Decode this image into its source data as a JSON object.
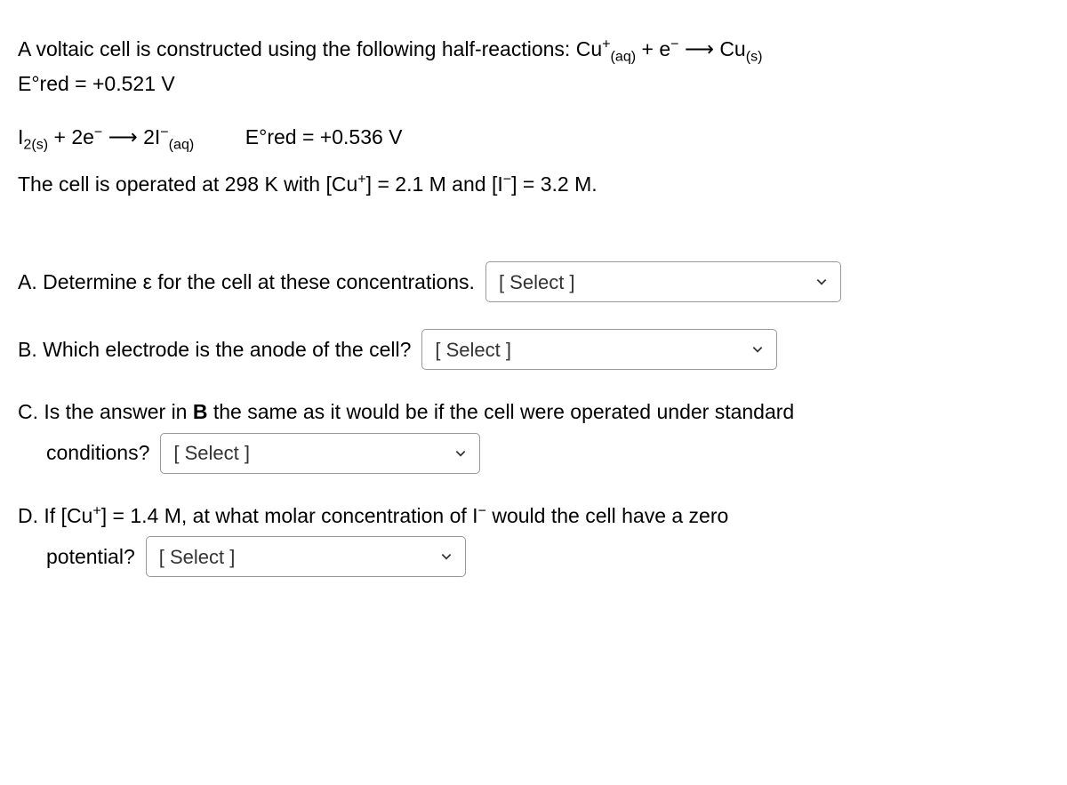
{
  "intro": {
    "text1": "A voltaic cell is constructed using the following half-reactions: Cu",
    "sup1": "+",
    "sub1": "(aq)",
    "text2": " + e",
    "sup2": "−",
    "arrow": " ⟶ Cu",
    "sub2": "(s)",
    "line2_pre": " E°red = +0.521 V"
  },
  "reaction2": {
    "text1": "I",
    "sub1": "2(s)",
    "text2": " + 2e",
    "sup1": "−",
    "arrow": " ⟶ 2I",
    "sup2": "−",
    "sub2": "(aq)",
    "spacer": "         ",
    "ered": "E°red = +0.536 V"
  },
  "conditions": {
    "text1": "The cell is operated at 298 K with [Cu",
    "sup1": "+",
    "text2": "] = 2.1 M and [I",
    "sup2": "−",
    "text3": "] = 3.2 M."
  },
  "qa": {
    "text": "A. Determine ε for the cell at these concentrations.",
    "select": "[ Select ]"
  },
  "qb": {
    "text": "B. Which electrode is the anode of the cell?",
    "select": "[ Select ]"
  },
  "qc": {
    "line1": "C. Is the answer in ",
    "bold": "B",
    "line1b": " the same as it would be if the cell were operated under standard",
    "line2": "conditions?",
    "select": "[ Select ]"
  },
  "qd": {
    "text1": "D. If [Cu",
    "sup1": "+",
    "text2": "] = 1.4 M, at what molar concentration of I",
    "sup2": "−",
    "text3": " would the cell have a zero",
    "line2": "potential?",
    "select": "[ Select ]"
  }
}
